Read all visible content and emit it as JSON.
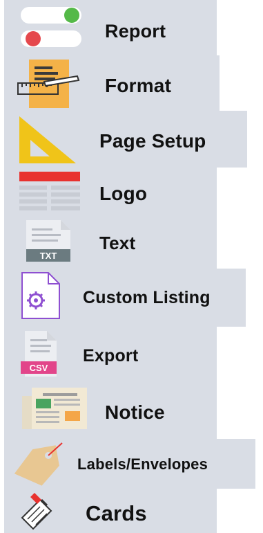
{
  "sidebar": {
    "items": [
      {
        "label": "Report",
        "icon": "toggle-switches-icon"
      },
      {
        "label": "Format",
        "icon": "document-ruler-icon"
      },
      {
        "label": "Page Setup",
        "icon": "set-square-icon"
      },
      {
        "label": "Logo",
        "icon": "logo-table-icon"
      },
      {
        "label": "Text",
        "icon": "txt-file-icon"
      },
      {
        "label": "Custom Listing",
        "icon": "gear-document-icon"
      },
      {
        "label": "Export",
        "icon": "csv-file-icon"
      },
      {
        "label": "Notice",
        "icon": "newspaper-icon"
      },
      {
        "label": "Labels/Envelopes",
        "icon": "tag-icon"
      },
      {
        "label": "Cards",
        "icon": "card-pen-icon"
      }
    ]
  },
  "colors": {
    "background": "#d9dde5",
    "toggle_green": "#54b948",
    "toggle_red": "#e5484d",
    "format_orange": "#f4b248",
    "setup_yellow": "#f0c419",
    "logo_red": "#e8322f",
    "custom_purple": "#8e4fd1",
    "csv_pink": "#e2458a",
    "tag_tan": "#e8c792"
  }
}
